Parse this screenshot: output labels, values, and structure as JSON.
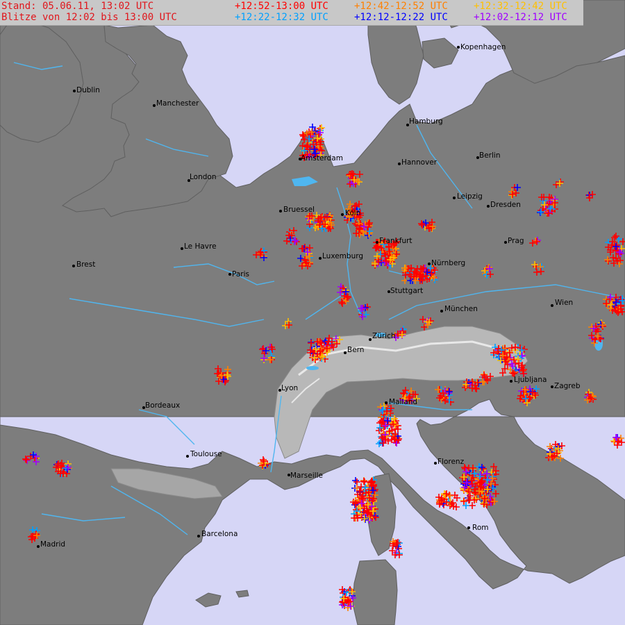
{
  "header": {
    "stand": "Stand: 05.06.11, 13:02 UTC",
    "blitze": "Blitze von 12:02 bis 13:00 UTC"
  },
  "legend": [
    {
      "label": "+12:52-13:00 UTC",
      "color": "#ff0000"
    },
    {
      "label": "+12:42-12:52 UTC",
      "color": "#ff8000"
    },
    {
      "label": "+12:32-12:42 UTC",
      "color": "#ffc000"
    },
    {
      "label": "+12:22-12:32 UTC",
      "color": "#00a0ff"
    },
    {
      "label": "+12:12-12:22 UTC",
      "color": "#0000ff"
    },
    {
      "label": "+12:02-12:12 UTC",
      "color": "#a000ff"
    }
  ],
  "colors": {
    "sea": "#d6d6f6",
    "land": "#7d7d7d",
    "rivers": "#4fb6f0",
    "alps": "#bdbdbd",
    "header_text": "#e0161c"
  },
  "cities": [
    {
      "name": "Dublin"
    },
    {
      "name": "Manchester"
    },
    {
      "name": "London"
    },
    {
      "name": "Amsterdam"
    },
    {
      "name": "Hamburg"
    },
    {
      "name": "Kopenhagen"
    },
    {
      "name": "Hannover"
    },
    {
      "name": "Berlin"
    },
    {
      "name": "Bruessel"
    },
    {
      "name": "Köln"
    },
    {
      "name": "Leipzig"
    },
    {
      "name": "Dresden"
    },
    {
      "name": "Le Havre"
    },
    {
      "name": "Paris"
    },
    {
      "name": "Brest"
    },
    {
      "name": "Luxemburg"
    },
    {
      "name": "Frankfurt"
    },
    {
      "name": "Prag"
    },
    {
      "name": "Nürnberg"
    },
    {
      "name": "Stuttgart"
    },
    {
      "name": "München"
    },
    {
      "name": "Wien"
    },
    {
      "name": "Zürich"
    },
    {
      "name": "Bern"
    },
    {
      "name": "Ljubljana"
    },
    {
      "name": "Zagreb"
    },
    {
      "name": "Lyon"
    },
    {
      "name": "Mailand"
    },
    {
      "name": "Bordeaux"
    },
    {
      "name": "Toulouse"
    },
    {
      "name": "Marseille"
    },
    {
      "name": "Florenz"
    },
    {
      "name": "Rom"
    },
    {
      "name": "Barcelona"
    },
    {
      "name": "Madrid"
    }
  ]
}
